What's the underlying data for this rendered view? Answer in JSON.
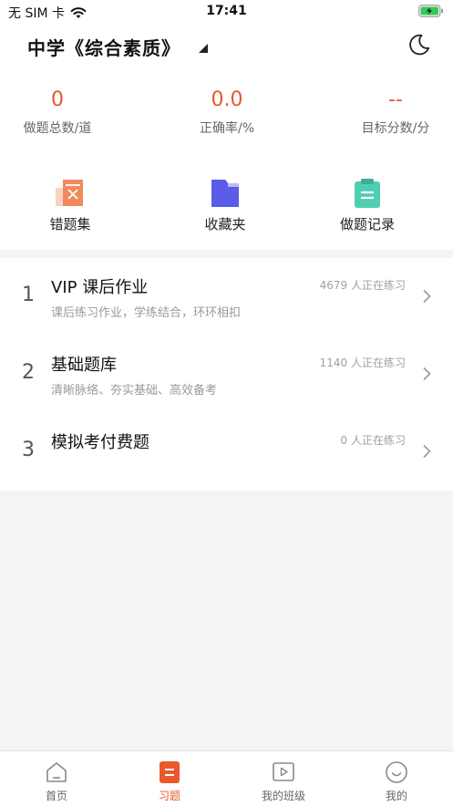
{
  "status_bar": {
    "carrier": "无 SIM 卡",
    "time": "17:41"
  },
  "header": {
    "title": "中学《综合素质》"
  },
  "stats": [
    {
      "value": "0",
      "label": "做题总数/道"
    },
    {
      "value": "0.0",
      "label": "正确率/%"
    },
    {
      "value": "--",
      "label": "目标分数/分"
    }
  ],
  "quick_links": [
    {
      "label": "错题集",
      "icon": "wrong-questions-icon",
      "color": "#f08a5d"
    },
    {
      "label": "收藏夹",
      "icon": "folder-icon",
      "color": "#5b5ce6"
    },
    {
      "label": "做题记录",
      "icon": "clipboard-icon",
      "color": "#4fcfb2"
    }
  ],
  "list": [
    {
      "number": "1",
      "title": "VIP 课后作业",
      "subtitle": "课后练习作业，学练结合，环环相扣",
      "count": "4679 人正在练习"
    },
    {
      "number": "2",
      "title": "基础题库",
      "subtitle": "清晰脉络、夯实基础、高效备考",
      "count": "1140 人正在练习"
    },
    {
      "number": "3",
      "title": "模拟考付费题",
      "subtitle": "",
      "count": "0 人正在练习"
    }
  ],
  "bottom_nav": [
    {
      "label": "首页",
      "icon": "home-icon",
      "active": false
    },
    {
      "label": "习题",
      "icon": "exercise-icon",
      "active": true
    },
    {
      "label": "我的班级",
      "icon": "class-video-icon",
      "active": false
    },
    {
      "label": "我的",
      "icon": "profile-icon",
      "active": false
    }
  ],
  "colors": {
    "accent": "#e8592c",
    "background": "#f4f4f6"
  }
}
